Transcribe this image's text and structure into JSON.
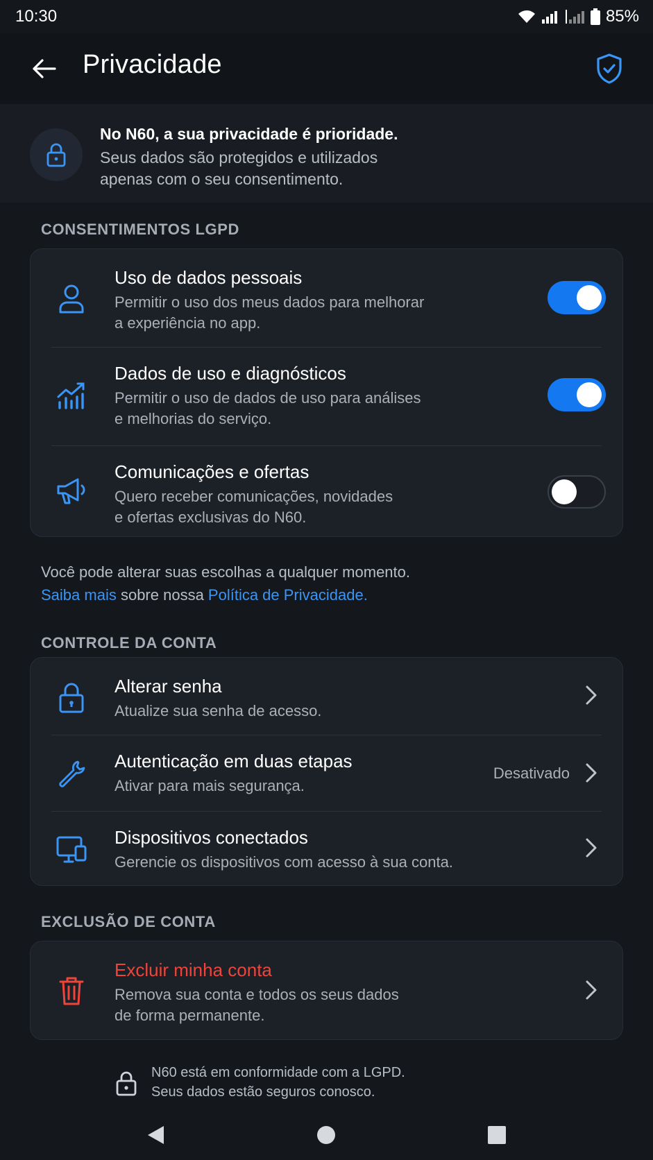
{
  "status_bar": {
    "time": "10:30",
    "battery": "85%"
  },
  "app_bar": {
    "title": "Privacidade"
  },
  "intro": {
    "title": "No N60, a sua privacidade é prioridade.",
    "text_line1": "Seus dados são protegidos e utilizados",
    "text_line2": "apenas com o seu consentimento."
  },
  "consent": {
    "section_label": "CONSENTIMENTOS LGPD",
    "items": [
      {
        "title": "Uso de dados pessoais",
        "sub1": "Permitir o uso dos meus dados para melhorar",
        "sub2": "a experiência no app.",
        "enabled": true,
        "icon": "user-icon"
      },
      {
        "title": "Dados de uso e diagnósticos",
        "sub1": "Permitir o uso de dados de uso para análises",
        "sub2": "e melhorias do serviço.",
        "enabled": true,
        "icon": "analytics-chart-icon"
      },
      {
        "title": "Comunicações e ofertas",
        "sub1": "Quero receber comunicações, novidades",
        "sub2": "e ofertas exclusivas do N60.",
        "enabled": false,
        "icon": "megaphone-icon"
      }
    ]
  },
  "note": {
    "line1": "Você pode alterar suas escolhas a qualquer momento.",
    "link1": "Saiba mais",
    "middle": " sobre nossa ",
    "link2": "Política de Privacidade."
  },
  "account": {
    "section_label": "CONTROLE DA CONTA",
    "items": [
      {
        "title": "Alterar senha",
        "sub": "Atualize sua senha de acesso.",
        "icon": "lock-icon"
      },
      {
        "title": "Autenticação em duas etapas",
        "sub": "Ativar para mais segurança.",
        "value": "Desativado",
        "icon": "wrench-icon"
      },
      {
        "title": "Dispositivos conectados",
        "sub": "Gerencie os dispositivos com acesso à sua conta.",
        "icon": "devices-icon"
      }
    ]
  },
  "deletion": {
    "section_label": "EXCLUSÃO DE CONTA",
    "title": "Excluir minha conta",
    "sub1": "Remova sua conta e todos os seus dados",
    "sub2": "de forma permanente.",
    "icon": "trash-icon"
  },
  "footer": {
    "line1": "N60 está em conformidade com a LGPD.",
    "line2": "Seus dados estão seguros conosco."
  },
  "colors": {
    "accent": "#1478f0",
    "link": "#3b95f5",
    "danger": "#f0443a",
    "background": "#14171c",
    "card": "#1c2027"
  }
}
